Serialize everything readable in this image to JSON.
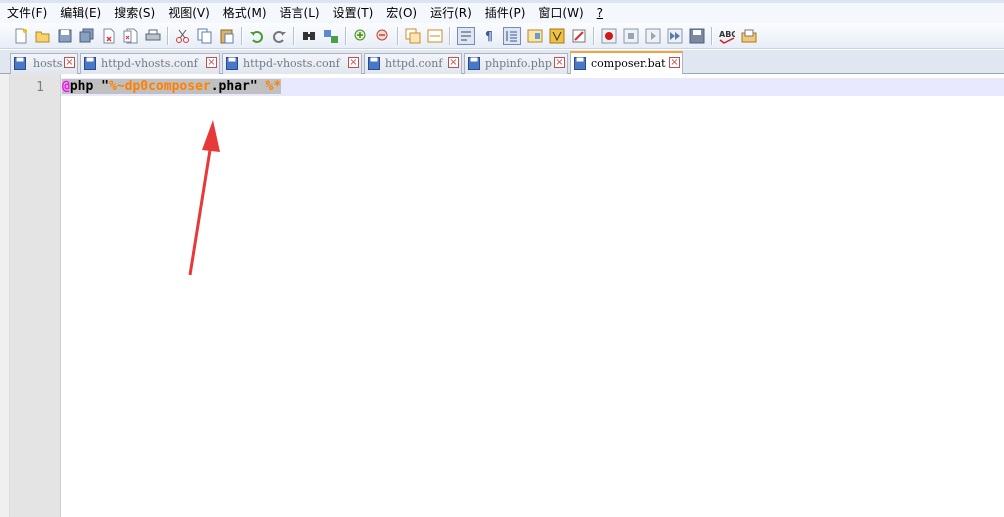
{
  "menubar": {
    "items": [
      "文件(F)",
      "编辑(E)",
      "搜索(S)",
      "视图(V)",
      "格式(M)",
      "语言(L)",
      "设置(T)",
      "宏(O)",
      "运行(R)",
      "插件(P)",
      "窗口(W)",
      "?"
    ]
  },
  "toolbar": {
    "icons": [
      "new-file-icon",
      "open-file-icon",
      "save-icon",
      "save-all-icon",
      "close-icon",
      "close-all-icon",
      "print-icon",
      "cut-icon",
      "copy-icon",
      "paste-icon",
      "undo-icon",
      "redo-icon",
      "find-icon",
      "replace-icon",
      "zoom-in-icon",
      "zoom-out-icon",
      "sync-vertical-icon",
      "sync-horizontal-icon",
      "word-wrap-icon",
      "show-all-chars-icon",
      "indent-guide-icon",
      "doc-map-icon",
      "function-list-icon",
      "folder-workspace-icon",
      "record-macro-icon",
      "stop-record-icon",
      "play-macro-icon",
      "run-macro-multiple-icon",
      "save-macro-icon",
      "spell-check-icon",
      "plugin-icon"
    ]
  },
  "tabs": [
    {
      "label": "hosts",
      "active": false
    },
    {
      "label": "httpd-vhosts.conf",
      "active": false
    },
    {
      "label": "httpd-vhosts.conf",
      "active": false
    },
    {
      "label": "httpd.conf",
      "active": false
    },
    {
      "label": "phpinfo.php",
      "active": false
    },
    {
      "label": "composer.bat",
      "active": true
    }
  ],
  "tab_close_glyph": "×",
  "editor": {
    "line_number": "1",
    "tokens": {
      "at": "@",
      "cmd": "php \"",
      "var1": "%~dp0",
      "word": "composer",
      "ext": ".phar\" ",
      "var2": "%*"
    }
  },
  "colors": {
    "accent_tab": "#f2a33a",
    "annotation_arrow": "#e8393a",
    "batch_variable": "#ff8000",
    "at_symbol": "#ff00ff"
  }
}
